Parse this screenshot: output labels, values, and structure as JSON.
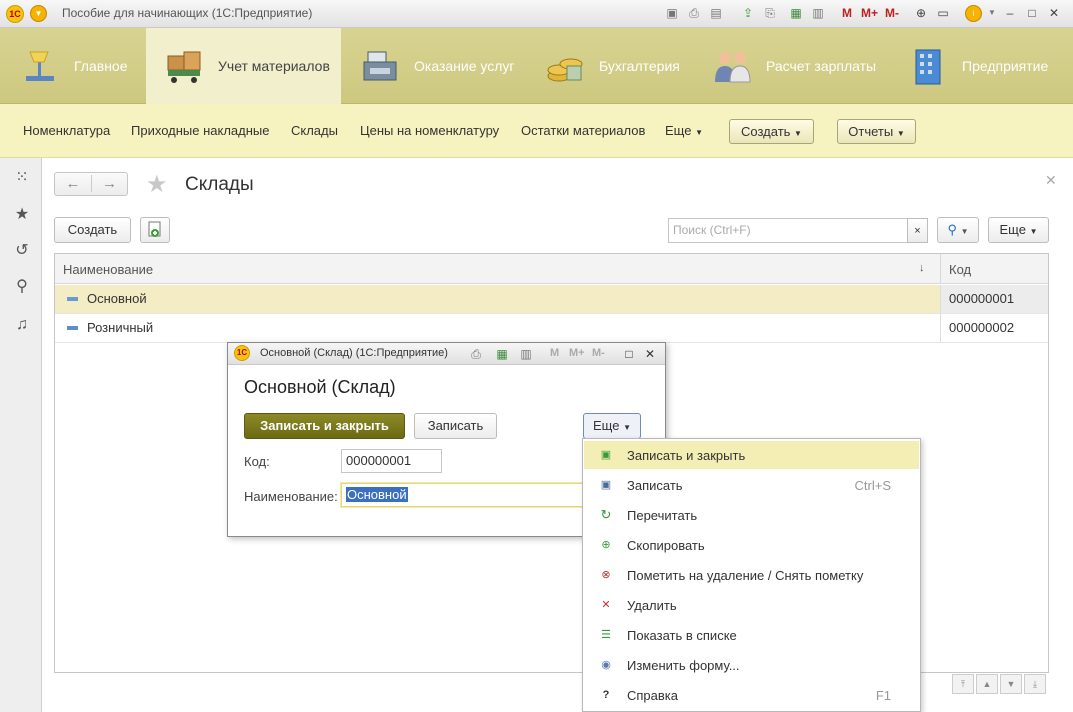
{
  "titlebar": {
    "app_title": "Пособие для начинающих  (1С:Предприятие)",
    "logo": "1С",
    "m_labels": [
      "M",
      "M+",
      "M-"
    ]
  },
  "sections": [
    {
      "label": "Главное",
      "icon": "desk-lamp-icon"
    },
    {
      "label": "Учет материалов",
      "icon": "boxes-cart-icon"
    },
    {
      "label": "Оказание услуг",
      "icon": "cash-register-icon"
    },
    {
      "label": "Бухгалтерия",
      "icon": "coins-icon"
    },
    {
      "label": "Расчет зарплаты",
      "icon": "people-icon"
    },
    {
      "label": "Предприятие",
      "icon": "building-icon"
    }
  ],
  "funcbar": {
    "items": [
      "Номенклатура",
      "Приходные накладные",
      "Склады",
      "Цены на номенклатуру",
      "Остатки материалов"
    ],
    "more": "Еще",
    "create": "Создать",
    "reports": "Отчеты"
  },
  "form": {
    "title": "Склады",
    "create_button": "Создать",
    "search_placeholder": "Поиск (Ctrl+F)",
    "more_button": "Еще",
    "columns": {
      "name": "Наименование",
      "code": "Код"
    },
    "rows": [
      {
        "name": "Основной",
        "code": "000000001"
      },
      {
        "name": "Розничный",
        "code": "000000002"
      }
    ]
  },
  "popup": {
    "window_title": "Основной (Склад)  (1С:Предприятие)",
    "heading": "Основной (Склад)",
    "save_close": "Записать и закрыть",
    "save": "Записать",
    "more": "Еще",
    "code_label": "Код:",
    "code_value": "000000001",
    "name_label": "Наименование:",
    "name_value": "Основной"
  },
  "menu": [
    {
      "label": "Записать и закрыть",
      "shortcut": "",
      "icon": "save-close-icon"
    },
    {
      "label": "Записать",
      "shortcut": "Ctrl+S",
      "icon": "floppy-icon"
    },
    {
      "label": "Перечитать",
      "shortcut": "",
      "icon": "refresh-icon"
    },
    {
      "label": "Скопировать",
      "shortcut": "",
      "icon": "copy-icon"
    },
    {
      "label": "Пометить на удаление / Снять пометку",
      "shortcut": "",
      "icon": "mark-delete-icon"
    },
    {
      "label": "Удалить",
      "shortcut": "",
      "icon": "delete-icon"
    },
    {
      "label": "Показать в списке",
      "shortcut": "",
      "icon": "show-in-list-icon"
    },
    {
      "label": "Изменить форму...",
      "shortcut": "",
      "icon": "form-settings-icon"
    },
    {
      "label": "Справка",
      "shortcut": "F1",
      "icon": "help-icon"
    }
  ]
}
